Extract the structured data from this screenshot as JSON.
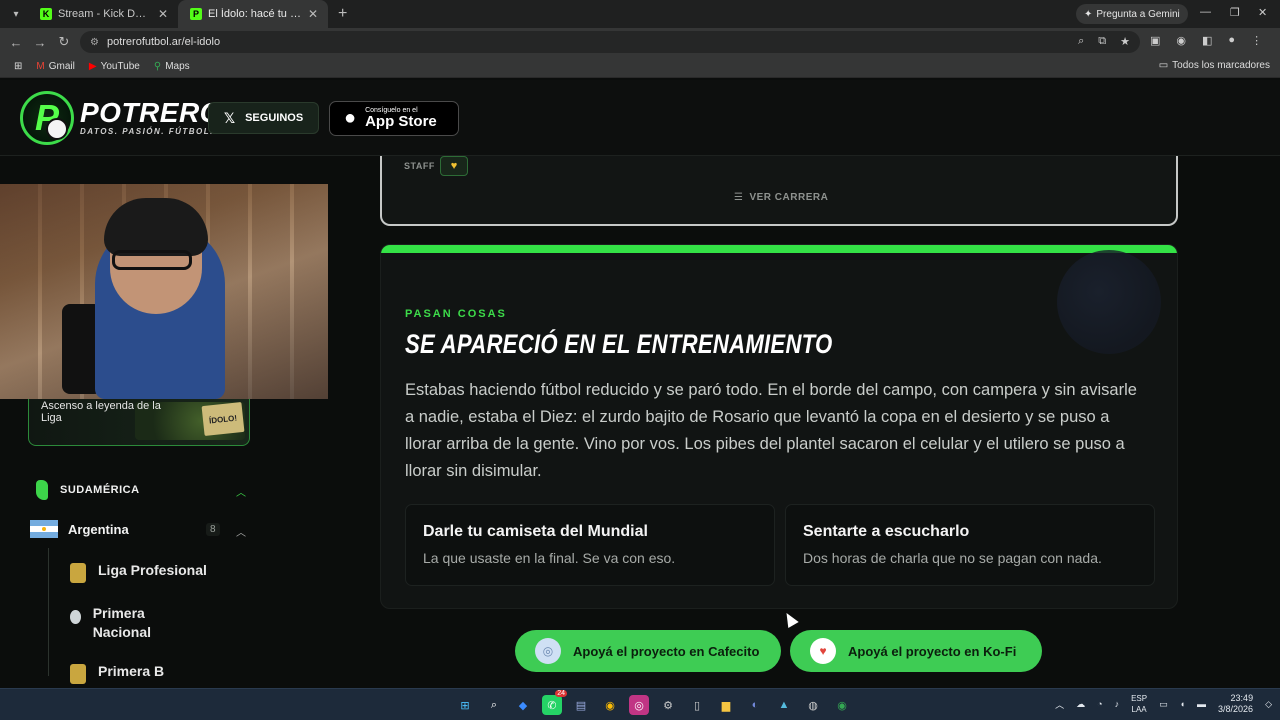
{
  "browser": {
    "tabs": [
      {
        "title": "Stream - Kick Dashboard",
        "active": false
      },
      {
        "title": "El Ídolo: hacé tu carrera en la Li",
        "active": true
      }
    ],
    "gemini_label": "Pregunta a Gemini",
    "url": "potrerofutbol.ar/el-idolo",
    "bookmarks": [
      "Gmail",
      "YouTube",
      "Maps"
    ],
    "all_bookmarks": "Todos los marcadores"
  },
  "header": {
    "brand": "POTRERO",
    "tagline": "DATOS. PASIÓN. FÚTBOL.",
    "follow_label": "SEGUINOS",
    "appstore_small": "Consíguelo en el",
    "appstore_big": "App Store"
  },
  "sidebar": {
    "legend_card": "Ascenso a leyenda de la Liga",
    "legend_stamp": "ÍDOLO!",
    "region": "SUDAMÉRICA",
    "country": "Argentina",
    "country_count": "8",
    "leagues": [
      "Liga Profesional",
      "Primera Nacional",
      "Primera B"
    ]
  },
  "career_card": {
    "staff_label": "STAFF",
    "ver_carrera": "VER CARRERA"
  },
  "event": {
    "kicker": "PASAN COSAS",
    "title": "SE APARECIÓ EN EL ENTRENAMIENTO",
    "body": "Estabas haciendo fútbol reducido y se paró todo. En el borde del campo, con campera y sin avisarle a nadie, estaba el Diez: el zurdo bajito de Rosario que levantó la copa en el desierto y se puso a llorar arriba de la gente. Vino por vos. Los pibes del plantel sacaron el celular y el utilero se puso a llorar sin disimular.",
    "options": [
      {
        "title": "Darle tu camiseta del Mundial",
        "subtitle": "La que usaste en la final. Se va con eso."
      },
      {
        "title": "Sentarte a escucharlo",
        "subtitle": "Dos horas de charla que no se pagan con nada."
      }
    ]
  },
  "donate": {
    "cafecito": "Apoyá el proyecto en Cafecito",
    "kofi": "Apoyá el proyecto en Ko-Fi"
  },
  "taskbar": {
    "lang1": "ESP",
    "lang2": "LAA",
    "time": "23:49",
    "date": "3/8/2026",
    "badge": "24"
  },
  "colors": {
    "accent": "#34e246",
    "background": "#0b0d0c"
  }
}
